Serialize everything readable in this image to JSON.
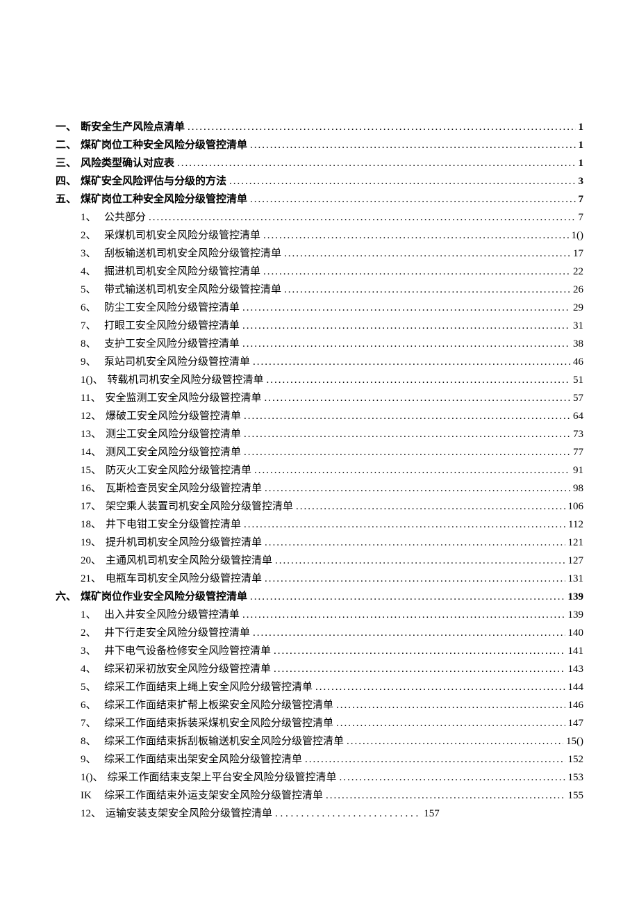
{
  "toc": [
    {
      "level": 0,
      "num": "一、",
      "title": "断安全生产风险点清单",
      "page": "1"
    },
    {
      "level": 0,
      "num": "二、",
      "title": "煤矿岗位工种安全风险分级管控清单",
      "page": "1"
    },
    {
      "level": 0,
      "num": "三、",
      "title": "风险类型确认对应表",
      "page": "1"
    },
    {
      "level": 0,
      "num": "四、",
      "title": "煤矿安全风险评估与分级的方法",
      "page": "3"
    },
    {
      "level": 0,
      "num": "五、",
      "title": "煤矿岗位工种安全风险分级管控清单",
      "page": "7"
    },
    {
      "level": 1,
      "num": "1、",
      "title": "公共部分",
      "page": "7"
    },
    {
      "level": 1,
      "num": "2、",
      "title": "采煤机司机安全风险分级管控清单",
      "page": "1()"
    },
    {
      "level": 1,
      "num": "3、",
      "title": "刮板输送机司机安全风险分级管控清单",
      "page": "17"
    },
    {
      "level": 1,
      "num": "4、",
      "title": "掘进机司机安全风险分级管控清单",
      "page": "22"
    },
    {
      "level": 1,
      "num": "5、",
      "title": "带式输送机司机安全风险分级管控清单",
      "page": "26"
    },
    {
      "level": 1,
      "num": "6、",
      "title": "防尘工安全风险分级管控清单",
      "page": "29"
    },
    {
      "level": 1,
      "num": "7、",
      "title": "打眼工安全风险分级管控清单",
      "page": "31"
    },
    {
      "level": 1,
      "num": "8、",
      "title": "支护工安全风险分级管控清单",
      "page": "38"
    },
    {
      "level": 1,
      "num": "9、",
      "title": "泵站司机安全风险分级管控清单",
      "page": "46"
    },
    {
      "level": 1,
      "num": "1()、",
      "title": "转载机司机安全风险分级管控清单",
      "page": "51"
    },
    {
      "level": 1,
      "num": "11、",
      "title": "安全监测工安全风险分级管控清单",
      "page": "57"
    },
    {
      "level": 1,
      "num": "12、",
      "title": "爆破工安全风险分级管控清单",
      "page": "64"
    },
    {
      "level": 1,
      "num": "13、",
      "title": "测尘工安全风险分级管控清单",
      "page": "73"
    },
    {
      "level": 1,
      "num": "14、",
      "title": "测风工安全风险分级管控清单",
      "page": "77"
    },
    {
      "level": 1,
      "num": "15、",
      "title": "防灭火工安全风险分级管控清单",
      "page": "91"
    },
    {
      "level": 1,
      "num": "16、",
      "title": "瓦斯检查员安全风险分级管控清单",
      "page": "98"
    },
    {
      "level": 1,
      "num": "17、",
      "title": "架空乘人装置司机安全风险分级管控清单",
      "page": "106"
    },
    {
      "level": 1,
      "num": "18、",
      "title": "井下电钳工安全分级管控清单",
      "page": "112"
    },
    {
      "level": 1,
      "num": "19、",
      "title": "提升机司机安全风险分级管控清单",
      "page": "121"
    },
    {
      "level": 1,
      "num": "20、",
      "title": "主通风机司机安全风险分级管控清单",
      "page": "127"
    },
    {
      "level": 1,
      "num": "21、",
      "title": "电瓶车司机安全风险分级管控清单",
      "page": "131"
    },
    {
      "level": 0,
      "num": "六、",
      "title": "煤矿岗位作业安全风险分级管控清单",
      "page": "139"
    },
    {
      "level": 1,
      "num": "1、",
      "title": "出入井安全风险分级管控清单",
      "page": "139"
    },
    {
      "level": 1,
      "num": "2、",
      "title": "井下行走安全风险分级管控清单",
      "page": "140"
    },
    {
      "level": 1,
      "num": "3、",
      "title": "井下电气设备检修安全风险管控清单",
      "page": "141"
    },
    {
      "level": 1,
      "num": "4、",
      "title": "综采初采初放安全风险分级管控清单",
      "page": "143"
    },
    {
      "level": 1,
      "num": "5、",
      "title": "综采工作面结束上绳上安全风险分级管控清单",
      "page": "144"
    },
    {
      "level": 1,
      "num": "6、",
      "title": "综采工作面结束扩帮上板梁安全风险分级管控清单",
      "page": "146"
    },
    {
      "level": 1,
      "num": "7、",
      "title": "综采工作面结束拆装采煤机安全风险分级管控清单",
      "page": "147"
    },
    {
      "level": 1,
      "num": "8、",
      "title": "综采工作面结束拆刮板输送机安全风险分级管控清单",
      "page": "15()"
    },
    {
      "level": 1,
      "num": "9、",
      "title": "综采工作面结束出架安全风险分级管控清单",
      "page": "152"
    },
    {
      "level": 1,
      "num": "1()、",
      "title": "综采工作面结束支架上平台安全风险分级管控清单",
      "page": "153"
    },
    {
      "level": 1,
      "num": "IK",
      "title": " 综采工作面结束外运支架安全风险分级管控清单 ",
      "page": "155"
    },
    {
      "level": 1,
      "num": "12、",
      "title": "运输安装支架安全风险分级管控清单  ",
      "page": "157",
      "short_dots": true
    }
  ]
}
